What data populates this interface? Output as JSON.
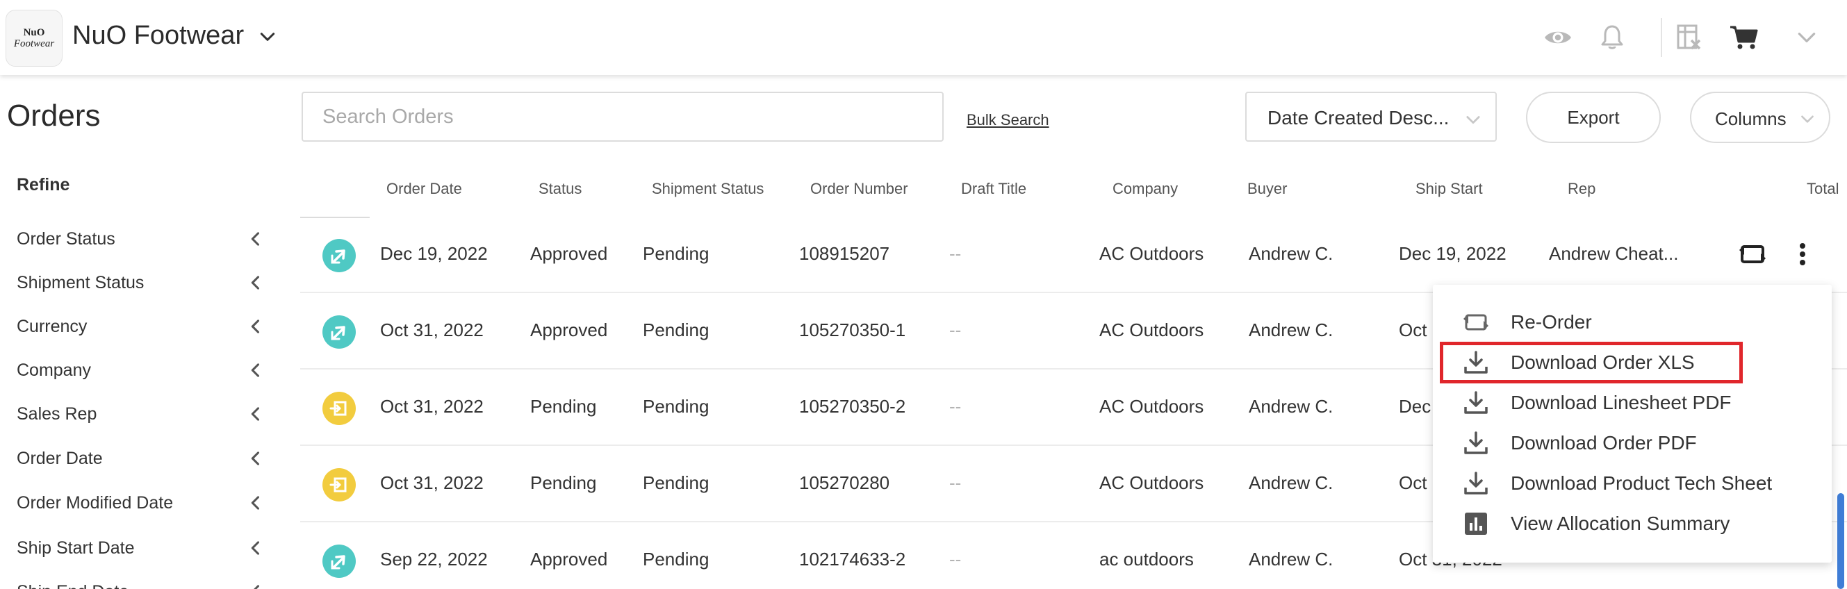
{
  "header": {
    "logo_line1": "NuO",
    "logo_line2": "Footwear",
    "brand": "NuO Footwear"
  },
  "icons": {
    "eye": "eye-icon",
    "bell": "bell-icon",
    "spreadsheet": "spreadsheet-icon",
    "cart": "cart-icon",
    "chevron": "chevron-down-icon"
  },
  "page": {
    "title": "Orders",
    "refine_label": "Refine"
  },
  "filters": [
    {
      "label": "Order Status"
    },
    {
      "label": "Shipment Status"
    },
    {
      "label": "Currency"
    },
    {
      "label": "Company"
    },
    {
      "label": "Sales Rep"
    },
    {
      "label": "Order Date"
    },
    {
      "label": "Order Modified Date"
    },
    {
      "label": "Ship Start Date"
    },
    {
      "label": "Ship End Date"
    }
  ],
  "toolbar": {
    "search_placeholder": "Search Orders",
    "bulk_search": "Bulk Search",
    "sort_value": "Date Created Desc...",
    "export": "Export",
    "columns": "Columns"
  },
  "table": {
    "headers": [
      "Order Date",
      "Status",
      "Shipment Status",
      "Order Number",
      "Draft Title",
      "Company",
      "Buyer",
      "Ship Start",
      "Rep",
      "Total"
    ],
    "rows": [
      {
        "badge": "teal",
        "order_date": "Dec 19, 2022",
        "status": "Approved",
        "shipment": "Pending",
        "number": "108915207",
        "draft": "--",
        "company": "AC Outdoors",
        "buyer": "Andrew C.",
        "ship_start": "Dec 19, 2022",
        "rep": "Andrew Cheat..."
      },
      {
        "badge": "teal",
        "order_date": "Oct 31, 2022",
        "status": "Approved",
        "shipment": "Pending",
        "number": "105270350-1",
        "draft": "--",
        "company": "AC Outdoors",
        "buyer": "Andrew C.",
        "ship_start": "Oct"
      },
      {
        "badge": "yellow",
        "order_date": "Oct 31, 2022",
        "status": "Pending",
        "shipment": "Pending",
        "number": "105270350-2",
        "draft": "--",
        "company": "AC Outdoors",
        "buyer": "Andrew C.",
        "ship_start": "Dec"
      },
      {
        "badge": "yellow",
        "order_date": "Oct 31, 2022",
        "status": "Pending",
        "shipment": "Pending",
        "number": "105270280",
        "draft": "--",
        "company": "AC Outdoors",
        "buyer": "Andrew C.",
        "ship_start": "Oct"
      },
      {
        "badge": "teal",
        "order_date": "Sep 22, 2022",
        "status": "Approved",
        "shipment": "Pending",
        "number": "102174633-2",
        "draft": "--",
        "company": "ac outdoors",
        "buyer": "Andrew C.",
        "ship_start": "Oct 31, 2022"
      }
    ]
  },
  "menu": {
    "items": [
      {
        "label": "Re-Order",
        "icon": "reorder-icon"
      },
      {
        "label": "Download Order XLS",
        "icon": "download-icon"
      },
      {
        "label": "Download Linesheet PDF",
        "icon": "download-icon"
      },
      {
        "label": "Download Order PDF",
        "icon": "download-icon"
      },
      {
        "label": "Download Product Tech Sheet",
        "icon": "download-icon"
      },
      {
        "label": "View Allocation Summary",
        "icon": "chart-icon"
      }
    ],
    "highlighted_index": 1,
    "highlight_color": "#e0262b"
  },
  "colors": {
    "approved_badge": "#4fc9c4",
    "pending_badge": "#f2cc3e",
    "scrollbar": "#3f7dd6"
  }
}
